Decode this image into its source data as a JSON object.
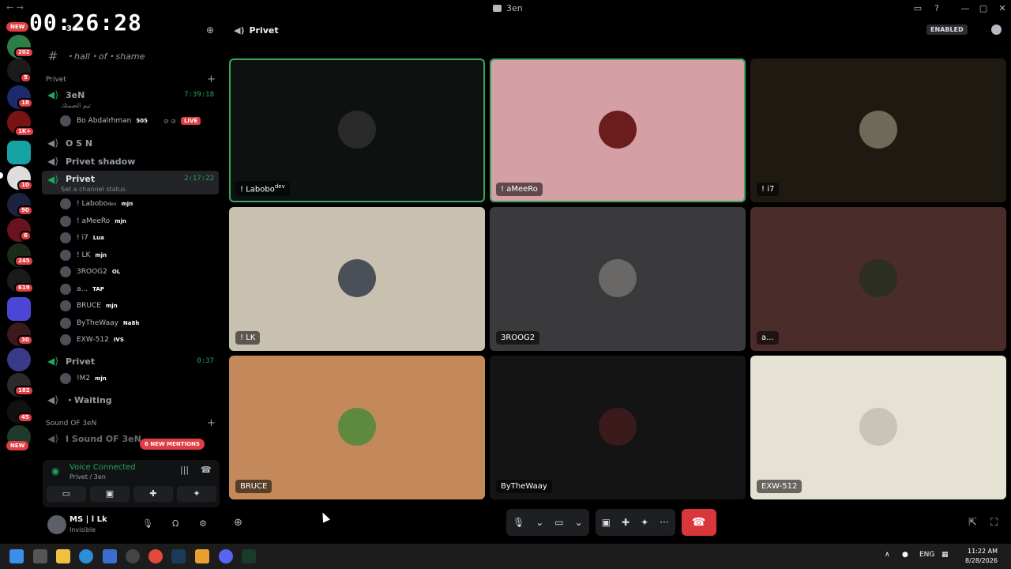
{
  "window": {
    "title": "3en",
    "timer": "00:26:28"
  },
  "rail": {
    "new_top": "NEW",
    "new_bottom": "NEW",
    "badges": [
      "202",
      "5",
      "18",
      "1K+",
      "10",
      "90",
      "6",
      "245",
      "619",
      "30",
      "182",
      "45"
    ]
  },
  "sidebar": {
    "server_name": "3en",
    "text_channel": "・hall・of・shame",
    "categories": [
      {
        "label": "Privet"
      },
      {
        "label": "Sound OF 3eN"
      }
    ],
    "channels": [
      {
        "name": "3eN",
        "time": "7:39:18",
        "status": "تيم الصمتك"
      },
      {
        "name": "O S N"
      },
      {
        "name": "Privet shadow"
      },
      {
        "name": "Privet",
        "time": "2:17:22",
        "status": "Set a channel status"
      },
      {
        "name": "Privet",
        "time": "0:37"
      },
      {
        "name": "・Waiting"
      },
      {
        "name": "I Sound OF 3eN"
      }
    ],
    "first_members": [
      {
        "name": "Bo Abdalrhman",
        "tag": "505",
        "live": "LIVE"
      }
    ],
    "members": [
      {
        "name": "! Labobo",
        "sup": "dev",
        "tag": "mjn"
      },
      {
        "name": "! aMeeRo",
        "tag": "mjn"
      },
      {
        "name": "! i7",
        "tag": "Lua"
      },
      {
        "name": "! LK",
        "tag": "mjn"
      },
      {
        "name": "3ROOG2",
        "tag": "OL"
      },
      {
        "name": "a...",
        "tag": "TAP"
      },
      {
        "name": "BRUCE",
        "tag": "mjn"
      },
      {
        "name": "ByTheWaay",
        "tag": "Na8h"
      },
      {
        "name": "EXW-512",
        "tag": "IVS"
      }
    ],
    "third_members": [
      {
        "name": "!M2",
        "tag": "mjn"
      }
    ],
    "mentions": "6 NEW MENTIONS"
  },
  "voice": {
    "status": "Voice Connected",
    "location": "Privet / 3en"
  },
  "user": {
    "name": "MS | l Lk",
    "status": "Invisible"
  },
  "main": {
    "channel": "Privet",
    "enabled": "ENABLED",
    "tiles": [
      {
        "label": "! Labobo",
        "sup": "dev",
        "bg": "#0d1210",
        "speaking": true,
        "av": "#2a2a2a"
      },
      {
        "label": "! aMeeRo",
        "bg": "#d4a0a6",
        "speaking": true,
        "av": "#6b1c1c"
      },
      {
        "label": "! i7",
        "bg": "#1e1a12",
        "speaking": false,
        "av": "#6e6a58"
      },
      {
        "label": "! LK",
        "bg": "#c9c1b0",
        "speaking": false,
        "av": "#4a5058"
      },
      {
        "label": "3ROOG2",
        "bg": "#3a393b",
        "speaking": false,
        "av": "#6a6866"
      },
      {
        "label": "a...",
        "bg": "#4a2c2b",
        "speaking": false,
        "av": "#2c2e22"
      },
      {
        "label": "BRUCE",
        "bg": "#c4895a",
        "speaking": false,
        "av": "#5d8a3e"
      },
      {
        "label": "ByTheWaay",
        "bg": "#141414",
        "speaking": false,
        "av": "#3a1a1a"
      },
      {
        "label": "EXW-512",
        "bg": "#e6e2d3",
        "speaking": false,
        "av": "#c8c4b8"
      }
    ]
  },
  "taskbar": {
    "lang": "ENG",
    "time": "11:22 AM",
    "date": "8/28/2026"
  }
}
